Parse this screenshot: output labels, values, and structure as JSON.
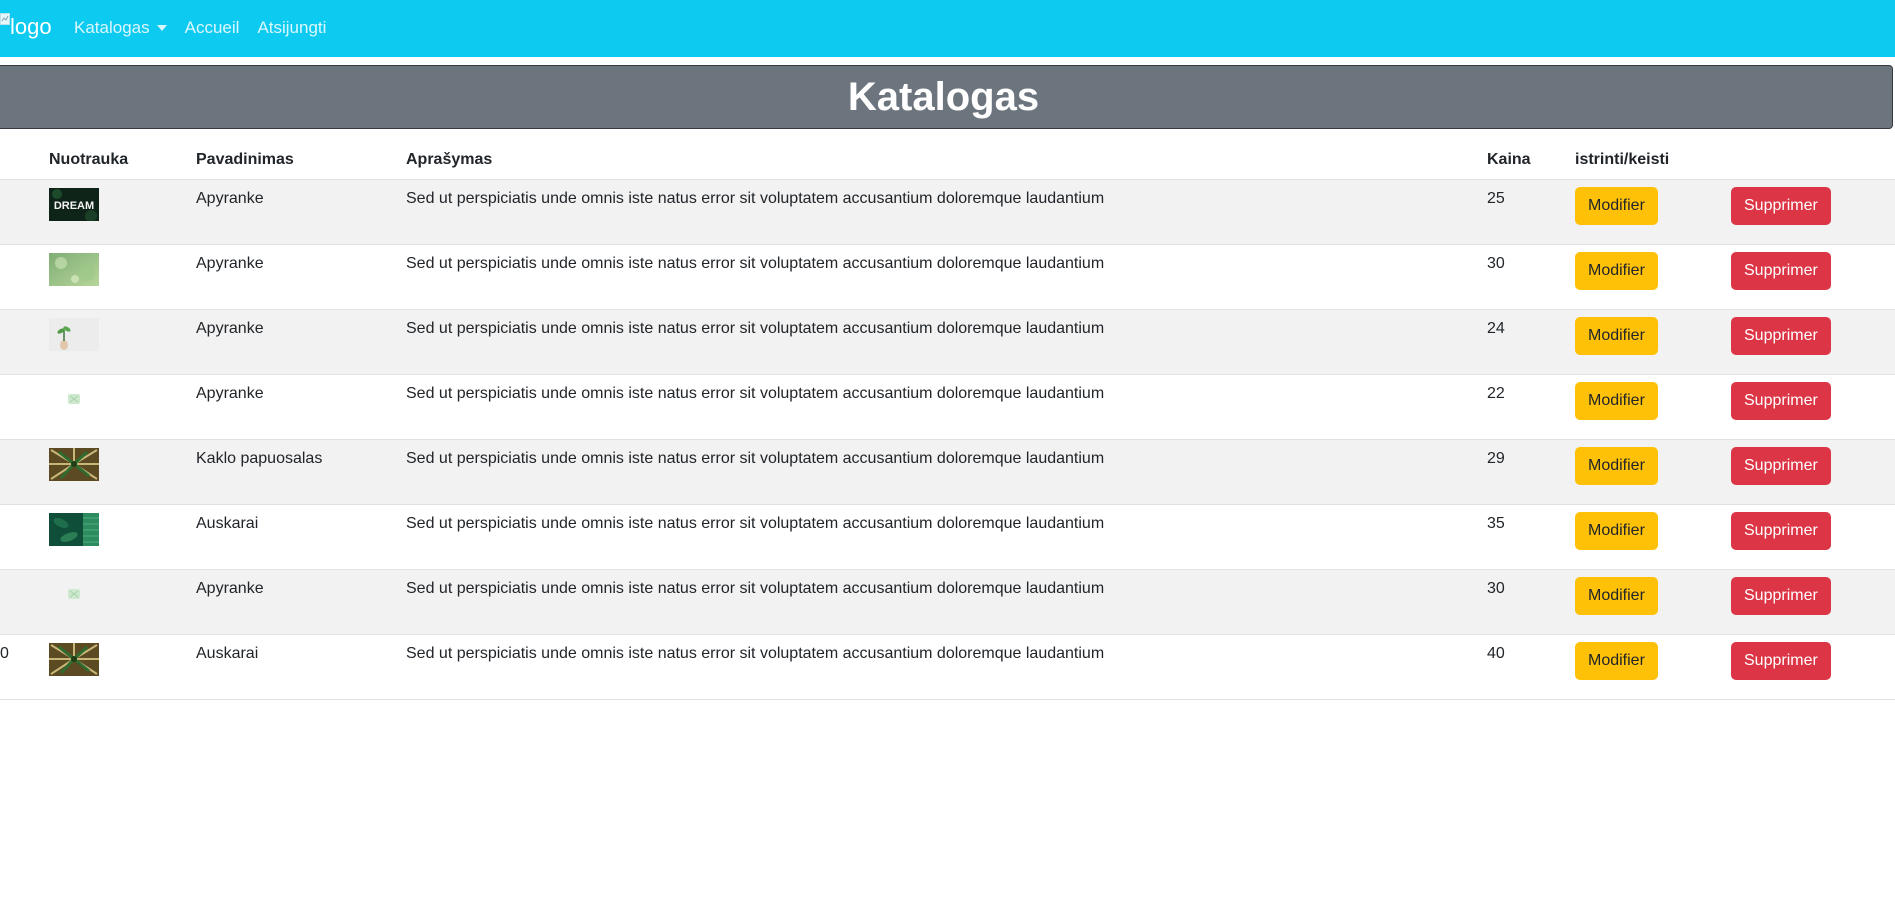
{
  "navbar": {
    "logo_alt": "logo",
    "items": [
      {
        "label": "Katalogas",
        "has_dropdown": true
      },
      {
        "label": "Accueil"
      },
      {
        "label": "Atsijungti"
      }
    ]
  },
  "banner": {
    "title": "Katalogas"
  },
  "table": {
    "headers": [
      "",
      "Nuotrauka",
      "Pavadinimas",
      "Aprašymas",
      "Kaina",
      "istrinti/keisti",
      ""
    ],
    "rows": [
      {
        "id": "",
        "thumb": "dream",
        "name": "Apyranke",
        "description": "Sed ut perspiciatis unde omnis iste natus error sit voluptatem accusantium doloremque laudantium",
        "price": "25",
        "edit": "Modifier",
        "delete": "Supprimer"
      },
      {
        "id": "",
        "thumb": "bokeh",
        "name": "Apyranke",
        "description": "Sed ut perspiciatis unde omnis iste natus error sit voluptatem accusantium doloremque laudantium",
        "price": "30",
        "edit": "Modifier",
        "delete": "Supprimer"
      },
      {
        "id": "",
        "thumb": "plant",
        "name": "Apyranke",
        "description": "Sed ut perspiciatis unde omnis iste natus error sit voluptatem accusantium doloremque laudantium",
        "price": "24",
        "edit": "Modifier",
        "delete": "Supprimer"
      },
      {
        "id": "",
        "thumb": "small",
        "name": "Apyranke",
        "description": "Sed ut perspiciatis unde omnis iste natus error sit voluptatem accusantium doloremque laudantium",
        "price": "22",
        "edit": "Modifier",
        "delete": "Supprimer"
      },
      {
        "id": "",
        "thumb": "palm",
        "name": "Kaklo papuosalas",
        "description": "Sed ut perspiciatis unde omnis iste natus error sit voluptatem accusantium doloremque laudantium",
        "price": "29",
        "edit": "Modifier",
        "delete": "Supprimer"
      },
      {
        "id": "",
        "thumb": "leaves",
        "name": "Auskarai",
        "description": "Sed ut perspiciatis unde omnis iste natus error sit voluptatem accusantium doloremque laudantium",
        "price": "35",
        "edit": "Modifier",
        "delete": "Supprimer"
      },
      {
        "id": "",
        "thumb": "small",
        "name": "Apyranke",
        "description": "Sed ut perspiciatis unde omnis iste natus error sit voluptatem accusantium doloremque laudantium",
        "price": "30",
        "edit": "Modifier",
        "delete": "Supprimer"
      },
      {
        "id": "0",
        "thumb": "palm",
        "name": "Auskarai",
        "description": "Sed ut perspiciatis unde omnis iste natus error sit voluptatem accusantium doloremque laudantium",
        "price": "40",
        "edit": "Modifier",
        "delete": "Supprimer"
      }
    ]
  },
  "colors": {
    "navbar": "#0dcaf0",
    "banner": "#6c757d",
    "edit_button": "#ffc107",
    "delete_button": "#dc3545"
  }
}
